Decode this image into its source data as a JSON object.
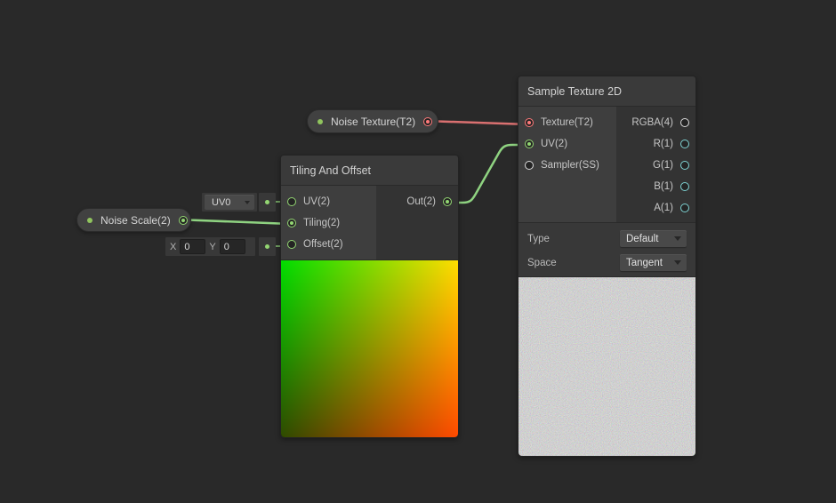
{
  "graph": {
    "background": "#292929"
  },
  "pills": {
    "noise_texture": {
      "label": "Noise Texture(T2)"
    },
    "noise_scale": {
      "label": "Noise Scale(2)"
    }
  },
  "tiling_node": {
    "title": "Tiling And Offset",
    "ports": {
      "uv": "UV(2)",
      "tiling": "Tiling(2)",
      "offset": "Offset(2)",
      "out": "Out(2)"
    },
    "uv_channel_value": "UV0",
    "offset_x_label": "X",
    "offset_x_value": "0",
    "offset_y_label": "Y",
    "offset_y_value": "0"
  },
  "sample_node": {
    "title": "Sample Texture 2D",
    "ports": {
      "texture": "Texture(T2)",
      "uv": "UV(2)",
      "sampler": "Sampler(SS)",
      "rgba": "RGBA(4)",
      "r": "R(1)",
      "g": "G(1)",
      "b": "B(1)",
      "a": "A(1)"
    },
    "type_label": "Type",
    "type_value": "Default",
    "space_label": "Space",
    "space_value": "Tangent"
  },
  "colors": {
    "wire_red": "#d97070",
    "wire_green": "#8fd381",
    "stub_green": "#6d9b5e",
    "port_red": "#ff7a7a",
    "port_green": "#93d672",
    "port_cyan": "#7fd4d4",
    "port_white": "#dcdcdc",
    "exposed_dot": "#90c45e"
  }
}
